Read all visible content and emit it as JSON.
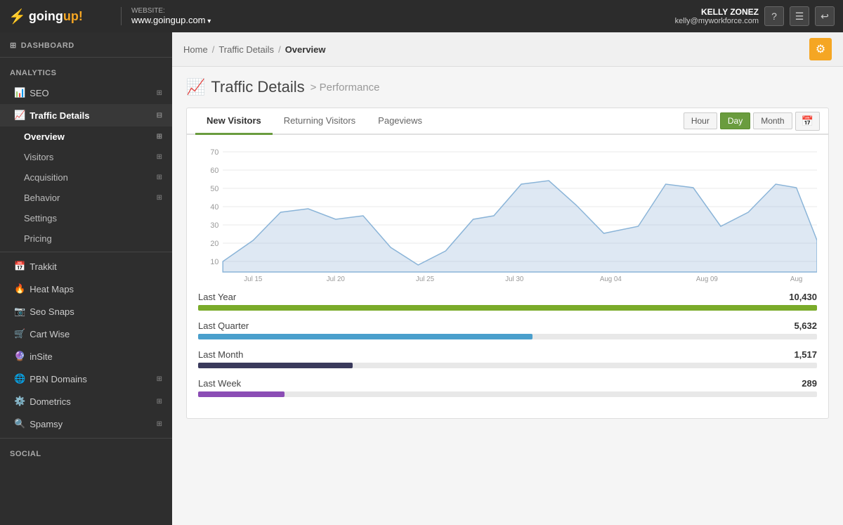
{
  "topbar": {
    "logo_text": "goingup!",
    "website_label": "WEBSITE:",
    "website_url": "www.goingup.com",
    "user_name": "KELLY ZONEZ",
    "user_email": "kelly@myworkforce.com",
    "help_btn": "?",
    "menu_btn": "☰",
    "back_btn": "↩"
  },
  "breadcrumb": {
    "home": "Home",
    "traffic_details": "Traffic Details",
    "current": "Overview"
  },
  "sidebar": {
    "dashboard_label": "DASHBOARD",
    "sections": [
      {
        "label": "Analytics",
        "items": [
          {
            "id": "seo",
            "label": "SEO",
            "icon": "bar-chart-icon",
            "expandable": true
          },
          {
            "id": "traffic-details",
            "label": "Traffic Details",
            "icon": "line-chart-icon",
            "expandable": true,
            "active": true,
            "subitems": [
              {
                "id": "overview",
                "label": "Overview",
                "active": true,
                "expandable": true
              },
              {
                "id": "visitors",
                "label": "Visitors",
                "expandable": true
              },
              {
                "id": "acquisition",
                "label": "Acquisition",
                "expandable": true
              },
              {
                "id": "behavior",
                "label": "Behavior",
                "expandable": true
              },
              {
                "id": "settings",
                "label": "Settings"
              },
              {
                "id": "pricing",
                "label": "Pricing"
              }
            ]
          }
        ]
      },
      {
        "label": "",
        "items": [
          {
            "id": "trakkit",
            "label": "Trakkit",
            "icon": "calendar-icon"
          },
          {
            "id": "heat-maps",
            "label": "Heat Maps",
            "icon": "flame-icon"
          },
          {
            "id": "seo-snaps",
            "label": "Seo Snaps",
            "icon": "camera-icon"
          },
          {
            "id": "cart-wise",
            "label": "Cart Wise",
            "icon": "cart-icon"
          },
          {
            "id": "insite",
            "label": "inSite",
            "icon": "gem-icon"
          },
          {
            "id": "pbn-domains",
            "label": "PBN Domains",
            "icon": "globe-icon",
            "expandable": true
          },
          {
            "id": "dometrics",
            "label": "Dometrics",
            "icon": "settings-icon",
            "expandable": true
          },
          {
            "id": "spamsy",
            "label": "Spamsy",
            "icon": "search-icon",
            "expandable": true
          }
        ]
      },
      {
        "label": "Social",
        "items": []
      }
    ]
  },
  "page": {
    "title": "Traffic Details",
    "subtitle": "> Performance",
    "title_icon": "📈"
  },
  "tabs": [
    {
      "id": "new-visitors",
      "label": "New Visitors",
      "active": true
    },
    {
      "id": "returning-visitors",
      "label": "Returning Visitors",
      "active": false
    },
    {
      "id": "pageviews",
      "label": "Pageviews",
      "active": false
    }
  ],
  "time_controls": [
    {
      "id": "hour",
      "label": "Hour",
      "active": false
    },
    {
      "id": "day",
      "label": "Day",
      "active": true
    },
    {
      "id": "month",
      "label": "Month",
      "active": false
    }
  ],
  "chart": {
    "y_labels": [
      "70",
      "60",
      "50",
      "40",
      "30",
      "20",
      "10"
    ],
    "x_labels": [
      "Jul 15",
      "Jul 20",
      "Jul 25",
      "Jul 30",
      "Aug 04",
      "Aug 09",
      "Aug"
    ]
  },
  "stats": [
    {
      "id": "last-year",
      "label": "Last Year",
      "value": "10,430",
      "bar_pct": 100,
      "color": "#7aab2a"
    },
    {
      "id": "last-quarter",
      "label": "Last Quarter",
      "value": "5,632",
      "bar_pct": 54,
      "color": "#4a9fcc"
    },
    {
      "id": "last-month",
      "label": "Last Month",
      "value": "1,517",
      "bar_pct": 25,
      "color": "#3a3a5c"
    },
    {
      "id": "last-week",
      "label": "Last Week",
      "value": "289",
      "bar_pct": 14,
      "color": "#8b4db5"
    }
  ]
}
